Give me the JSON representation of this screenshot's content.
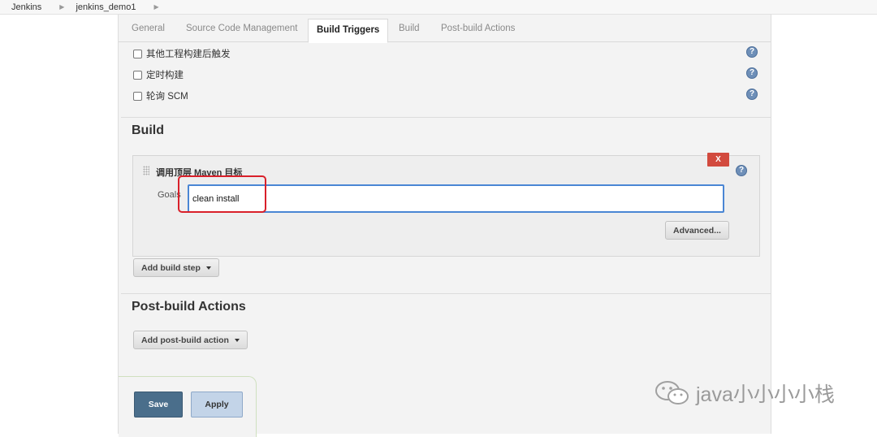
{
  "breadcrumb": {
    "items": [
      "Jenkins",
      "jenkins_demo1"
    ]
  },
  "tabs": [
    "General",
    "Source Code Management",
    "Build Triggers",
    "Build",
    "Post-build Actions"
  ],
  "triggers": [
    "其他工程构建后触发",
    "定时构建",
    "轮询 SCM"
  ],
  "help_glyph": "?",
  "build": {
    "title": "Build",
    "step_title": "调用顶层 Maven 目标",
    "goals_label": "Goals",
    "goals_value": "clean install",
    "delete_label": "X",
    "advanced_label": "Advanced...",
    "add_step_label": "Add build step"
  },
  "post_build": {
    "title": "Post-build Actions",
    "add_action_label": "Add post-build action"
  },
  "buttons": {
    "save": "Save",
    "apply": "Apply"
  },
  "watermark": {
    "text": "java小小小小栈"
  },
  "colors": {
    "highlight": "#d9202a",
    "delete": "#d24a3e",
    "save": "#4a6e8b",
    "apply": "#c3d4e8",
    "help": "#6e8fb8"
  }
}
